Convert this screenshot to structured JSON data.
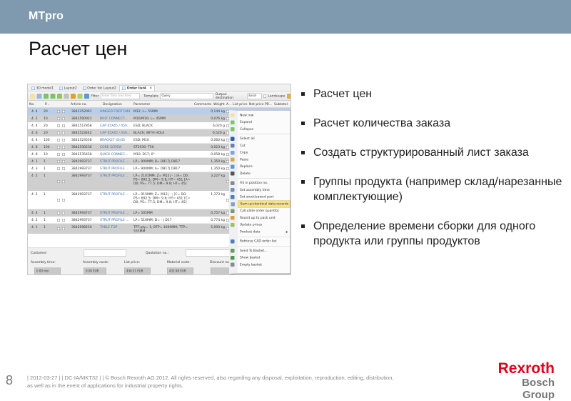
{
  "header": {
    "brand": "MTpro",
    "title": "Расчет цен",
    "bar_color": "#7f9aae"
  },
  "bullets": [
    "Расчет цен",
    "Расчет количества заказа",
    "Создать структурированный лист заказа",
    "Группы продукта (например склад/нарезанные комплектующие)",
    "Определение времени сборки для одного продукта или группы продуктов"
  ],
  "app": {
    "tabs": [
      "3D model1",
      "Layout2",
      "Order list Layout2",
      "Order list4"
    ],
    "active_tab": "Order list4",
    "toolbar": {
      "filter_label": "Filter",
      "filter_placeholder": "Enter filter text here",
      "template_label": "Template",
      "template_value": "Query",
      "output_label": "Output destination",
      "output_value": "Excel",
      "landscape_label": "Landscape"
    },
    "columns": [
      "No.",
      "P...",
      "Article no.",
      "Designation",
      "Parameter",
      "Comments",
      "Weight",
      "A...",
      "List price",
      "Net price",
      "PR...",
      "Subtotal"
    ],
    "rows": [
      {
        "no": "4. 4",
        "qty": "20",
        "article": "3842352061",
        "designation": "HINGED FOOT D44",
        "parameter": "M12; L= 55MM",
        "weight": "0,144 kg",
        "style": "sel"
      },
      {
        "no": "4. 2",
        "qty": "10",
        "article": "3842500921",
        "designation": "BOLT CONNECT...",
        "parameter": "M10/M10; L= 45MM",
        "weight": "0,076 kg",
        "style": "g"
      },
      {
        "no": "4. 4",
        "qty": "20",
        "article": "3842517858",
        "designation": "CAP 45X45 / 450...",
        "parameter": "ESD; BLACK",
        "weight": "6,020 g",
        "style": ""
      },
      {
        "no": "4. 6",
        "qty": "20",
        "article": "3842523442",
        "designation": "CAP 45X45 / 450...",
        "parameter": "BLACK; WITH HOLE",
        "weight": "6,520 g",
        "style": "g"
      },
      {
        "no": "4. 4",
        "qty": "100",
        "article": "3842523558",
        "designation": "BRACKET 45/45",
        "parameter": "ESD; M10",
        "weight": "0,060 kg",
        "style": ""
      },
      {
        "no": "4. 8",
        "qty": "100",
        "article": "3842530236",
        "designation": "CORE SCREW",
        "parameter": "ST2930- T50",
        "weight": "0,023 kg",
        "style": "g"
      },
      {
        "no": "4. 8",
        "qty": "10",
        "article": "3842535458",
        "designation": "QUICK CONNEC...",
        "parameter": "M10; D17; 0°",
        "weight": "0,058 kg",
        "style": ""
      },
      {
        "no": "4. 1",
        "qty": "1",
        "article": "3842993737",
        "designation": "STRUT PROFILE ...",
        "parameter": "LP= 900MM; B= D817| D817",
        "weight": "1,350 kg",
        "style": "g"
      },
      {
        "no": "4. 3",
        "qty": "1",
        "article": "3842993737",
        "designation": "STRUT PROFILE ...",
        "parameter": "LP= 900MM; A= D817| D817",
        "weight": "1,350 kg",
        "style": ""
      },
      {
        "no": "4. 2",
        "qty": "1",
        "article": "3842993737",
        "designation": "STRUT PROFILE ...",
        "parameter": "LP= 2101MM; Z= M12| - ; [A= D0; PS= 892.5; DM= 9.8; HT= 45]; [A= D0; PS= 77.5; DM= 9.8; HT= 45]",
        "weight": "3,227 kg",
        "style": "g",
        "tall": 3
      },
      {
        "no": "4. 2",
        "qty": "1",
        "article": "3842993737",
        "designation": "STRUT PROFILE ...",
        "parameter": "LP= 915MM; Z= M12| - ; [C= D0; PS= 892.5; DM= 9.8; HT= 45]; [C= D0; PS= 77.5; DM= 9.8; HT= 45]",
        "weight": "1,373 kg",
        "style": "",
        "tall": 3
      },
      {
        "no": "4. 4",
        "qty": "1",
        "article": "3842993737",
        "designation": "STRUT PROFILE ...",
        "parameter": "LP= 505MM",
        "weight": "0,757 kg",
        "style": "g"
      },
      {
        "no": "4. 2",
        "qty": "1",
        "article": "3842993737",
        "designation": "STRUT PROFILE ...",
        "parameter": "LP= 516MM; D= - | D17",
        "weight": "0,774 kg",
        "style": ""
      },
      {
        "no": "4. 1",
        "qty": "1",
        "article": "3842998250",
        "designation": "TABLE TOP",
        "parameter": "TPT;qty= 1; BTP= 1000MM; TTP= 555MM",
        "weight": "5,000 kg",
        "style": "g",
        "tall": 2
      }
    ],
    "summary": {
      "customer_label": "Customer:",
      "quotation_label": "Quotation no.:",
      "assembly_time_label": "Assembly time:",
      "assembly_time": "0.00 min",
      "assembly_costs_label": "Assembly costs:",
      "assembly_costs": "0.00 EUR",
      "list_price_label": "List price:",
      "list_price": "436.51 EUR",
      "material_costs_label": "Material costs:",
      "material_costs": "432.98 EUR",
      "discount_label": "Discount no.:"
    },
    "context_menu": [
      {
        "label": "New row",
        "icon": "new-row-icon",
        "color": "#f2e3a0"
      },
      {
        "label": "Expand",
        "icon": "expand-icon",
        "color": "#7cc46c"
      },
      {
        "label": "Collapse",
        "icon": "collapse-icon",
        "color": "#7cc46c"
      },
      {
        "sep": true
      },
      {
        "label": "Select all",
        "icon": "select-all-icon",
        "color": "#2a5db0"
      },
      {
        "label": "Cut",
        "icon": "cut-icon",
        "color": "#6a7fb0"
      },
      {
        "label": "Copy",
        "icon": "copy-icon",
        "color": "#7fa6d8"
      },
      {
        "label": "Paste",
        "icon": "paste-icon",
        "color": "#d9a84a"
      },
      {
        "label": "Replace",
        "icon": "replace-icon",
        "color": "#5b9bd5"
      },
      {
        "label": "Delete",
        "icon": "delete-icon",
        "color": "#555555"
      },
      {
        "sep": true
      },
      {
        "label": "Fill in position no.",
        "icon": "position-number-icon",
        "color": "#888888"
      },
      {
        "label": "Set assembly time",
        "icon": "clock-icon",
        "color": "#6f8fb8"
      },
      {
        "label": "Set stock/sawed part",
        "icon": "stock-icon",
        "color": "#4a7fc0"
      },
      {
        "label": "Sum up identical data records",
        "icon": "sum-icon",
        "color": "#8aa0c0",
        "highlighted": true
      },
      {
        "label": "Calculate order quantity",
        "icon": "calculate-icon",
        "color": "#7a9a6a"
      },
      {
        "label": "Round up to pack unit",
        "icon": "round-up-icon",
        "color": "#e0a030"
      },
      {
        "label": "Update prices",
        "icon": "update-prices-icon",
        "color": "#9ac060"
      },
      {
        "label": "Product data",
        "icon": "",
        "color": "",
        "submenu": true
      },
      {
        "sep": true
      },
      {
        "label": "Retrieve CAD order list",
        "icon": "cad-list-icon",
        "color": "#4a7fc0"
      },
      {
        "sep": true
      },
      {
        "label": "Send To Basket...",
        "icon": "send-basket-icon",
        "color": "#6a9a5a"
      },
      {
        "label": "Show basket",
        "icon": "show-basket-icon",
        "color": "#4a9a4a"
      },
      {
        "label": "Empty basket",
        "icon": "empty-basket-icon",
        "color": "#8a8a8a"
      }
    ]
  },
  "footer": {
    "page_number": "8",
    "text": "| 2012-03-27 | | DC-IA/MKT32 | | © Bosch Rexroth AG 2012. All rights reserved, also regarding any disposal, exploitation, reproduction, editing, distribution, as well as in the event of applications for industrial property rights.",
    "logo_line1": "Rexroth",
    "logo_line2": "Bosch Group",
    "logo_color": "#e2001a"
  }
}
